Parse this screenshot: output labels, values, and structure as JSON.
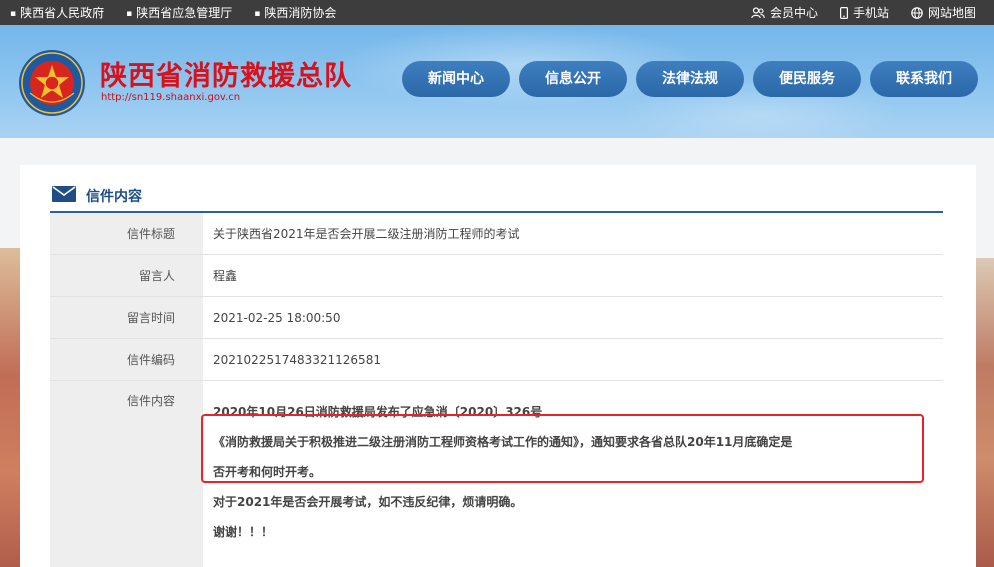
{
  "topbar": {
    "links": [
      "陕西省人民政府",
      "陕西省应急管理厅",
      "陕西消防协会"
    ],
    "member": "会员中心",
    "mobile": "手机站",
    "sitemap": "网站地图"
  },
  "header": {
    "title": "陕西省消防救援总队",
    "url": "http://sn119.shaanxi.gov.cn",
    "nav": [
      "新闻中心",
      "信息公开",
      "法律法规",
      "便民服务",
      "联系我们"
    ]
  },
  "section": {
    "title": "信件内容"
  },
  "letter": {
    "rows": [
      {
        "label": "信件标题",
        "value": "关于陕西省2021年是否会开展二级注册消防工程师的考试"
      },
      {
        "label": "留言人",
        "value": "程鑫"
      },
      {
        "label": "留言时间",
        "value": "2021-02-25 18:00:50"
      },
      {
        "label": "信件编码",
        "value": "20210225174833211265​81"
      }
    ],
    "content_label": "信件内容",
    "content": [
      "2020年10月26日消防救援局发布了应急消〔2020〕326号",
      "《消防救援局关于积极推进二级注册消防工程师资格考试工作的通知》，通知要求各省总队20年11月底确定是",
      "否开考和何时开考。",
      "对于2021年是否会开展考试，如不违反纪律，烦请明确。",
      "谢谢！！！"
    ]
  },
  "colors": {
    "accent": "#2a68a8",
    "title_red": "#d8111b",
    "highlight": "#e52526"
  }
}
